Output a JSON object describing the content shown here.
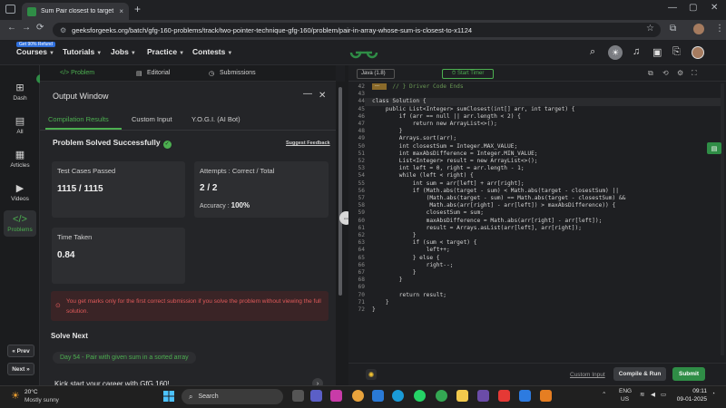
{
  "browser": {
    "tab_title": "Sum Pair closest to target | Prac",
    "tab_close": "×",
    "new_tab": "+",
    "back": "←",
    "forward": "→",
    "reload": "⟳",
    "url": "geeksforgeeks.org/batch/gfg-160-problems/track/two-pointer-technique-gfg-160/problem/pair-in-array-whose-sum-is-closest-to-x1124",
    "window_min": "—",
    "window_max": "▢",
    "window_close": "✕"
  },
  "header": {
    "refund_badge": "Get 90% Refund",
    "menu": [
      {
        "label": "Courses"
      },
      {
        "label": "Tutorials"
      },
      {
        "label": "Jobs"
      },
      {
        "label": "Practice"
      },
      {
        "label": "Contests"
      }
    ],
    "brand_color": "#2f8d46"
  },
  "sidebar": {
    "items": [
      {
        "label": "Dash",
        "icon": "⊞"
      },
      {
        "label": "All",
        "icon": "▤"
      },
      {
        "label": "Articles",
        "icon": "▦"
      },
      {
        "label": "Videos",
        "icon": "▶"
      },
      {
        "label": "Problems",
        "icon": "</>"
      }
    ],
    "prev_label": "« Prev",
    "next_label": "Next »"
  },
  "problem_tabs": [
    {
      "label": "</> Problem"
    },
    {
      "label": "Editorial"
    },
    {
      "label": "Submissions"
    }
  ],
  "output": {
    "title": "Output Window",
    "minimize": "—",
    "close": "✕",
    "tabs": [
      {
        "label": "Compilation Results"
      },
      {
        "label": "Custom Input"
      },
      {
        "label": "Y.O.G.I. (AI Bot)"
      }
    ],
    "status": "Problem Solved Successfully",
    "feedback": "Suggest Feedback",
    "test_cases_label": "Test Cases Passed",
    "test_cases_value": "1115 / 1115",
    "attempts_label": "Attempts : Correct / Total",
    "attempts_value": "2 / 2",
    "accuracy_label": "Accuracy :",
    "accuracy_value": "100%",
    "time_label": "Time Taken",
    "time_value": "0.84",
    "warning": "You get marks only for the first correct submission if you solve the problem without viewing the full solution.",
    "solve_next": "Solve Next",
    "next_problem": "Day 54 - Pair with given sum in a sorted array",
    "kickstart": "Kick start your career with GfG 160!",
    "kick_btn": "›"
  },
  "editor": {
    "language": "Java (1.8)",
    "timer": "Start Timer",
    "fold_marker": "...",
    "line_numbers": [
      "42",
      "43",
      "44",
      "45",
      "46",
      "47",
      "48",
      "49",
      "50",
      "51",
      "52",
      "53",
      "54",
      "55",
      "56",
      "57",
      "58",
      "59",
      "60",
      "61",
      "62",
      "63",
      "64",
      "65",
      "66",
      "67",
      "68",
      "69",
      "70",
      "71",
      "72"
    ],
    "lines": [
      "      // } Driver Code Ends",
      "",
      "class Solution {",
      "    public List<Integer> sumClosest(int[] arr, int target) {",
      "        if (arr == null || arr.length < 2) {",
      "            return new ArrayList<>();",
      "        }",
      "        Arrays.sort(arr);",
      "        int closestSum = Integer.MAX_VALUE;",
      "        int maxAbsDifference = Integer.MIN_VALUE;",
      "        List<Integer> result = new ArrayList<>();",
      "        int left = 0, right = arr.length - 1;",
      "        while (left < right) {",
      "            int sum = arr[left] + arr[right];",
      "            if (Math.abs(target - sum) < Math.abs(target - closestSum) ||",
      "                (Math.abs(target - sum) == Math.abs(target - closestSum) &&",
      "                 Math.abs(arr[right] - arr[left]) > maxAbsDifference)) {",
      "                closestSum = sum;",
      "                maxAbsDifference = Math.abs(arr[right] - arr[left]);",
      "                result = Arrays.asList(arr[left], arr[right]);",
      "            }",
      "            if (sum < target) {",
      "                left++;",
      "            } else {",
      "                right--;",
      "            }",
      "        }",
      "",
      "        return result;",
      "    }",
      "}"
    ],
    "custom_input": "Custom Input",
    "compile_run": "Compile & Run",
    "submit": "Submit"
  },
  "taskbar": {
    "temperature": "20°C",
    "condition": "Mostly sunny",
    "search": "Search",
    "lang_top": "ENG",
    "lang_bottom": "US",
    "time": "09:11",
    "date": "09-01-2025"
  }
}
